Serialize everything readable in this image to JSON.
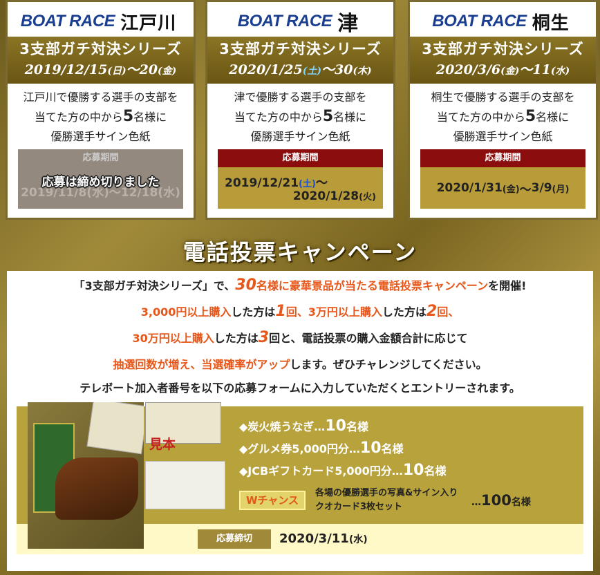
{
  "cards": [
    {
      "logo": "BOAT RACE",
      "venue": "江戸川",
      "series": "3支部ガチ対決シリーズ",
      "date_start": "2019/12/15",
      "dow_start": "(日)",
      "tilde": "～",
      "date_end": "20",
      "dow_end": "(金)",
      "desc1": "江戸川で優勝する選手の支部を",
      "desc2a": "当てた方の中から",
      "desc_num": "5",
      "desc2b": "名様に",
      "desc3": "優勝選手サイン色紙",
      "period_label": "応募期間",
      "period_old": "2019/11/8(水)～12/18(水)",
      "closed": "応募は締め切りました"
    },
    {
      "logo": "BOAT RACE",
      "venue": "津",
      "series": "3支部ガチ対決シリーズ",
      "date_start": "2020/1/25",
      "dow_start": "(土)",
      "tilde": "～",
      "date_end": "30",
      "dow_end": "(木)",
      "desc1": "津で優勝する選手の支部を",
      "desc2a": "当てた方の中から",
      "desc_num": "5",
      "desc2b": "名様に",
      "desc3": "優勝選手サイン色紙",
      "period_label": "応募期間",
      "p_line1": "2019/12/21",
      "p_dow1": "(土)",
      "p_tilde": "～",
      "p_line2": "2020/1/28",
      "p_dow2": "(火)"
    },
    {
      "logo": "BOAT RACE",
      "venue": "桐生",
      "series": "3支部ガチ対決シリーズ",
      "date_start": "2020/3/6",
      "dow_start": "(金)",
      "tilde": "～",
      "date_end": "11",
      "dow_end": "(水)",
      "desc1": "桐生で優勝する選手の支部を",
      "desc2a": "当てた方の中から",
      "desc_num": "5",
      "desc2b": "名様に",
      "desc3": "優勝選手サイン色紙",
      "period_label": "応募期間",
      "p_val": "2020/1/31",
      "p_dow1": "(金)",
      "p_tilde": "～",
      "p_val2": "3/9",
      "p_dow2": "(月)"
    }
  ],
  "campaign": {
    "title": "電話投票キャンペーン",
    "l1a": "「3支部ガチ対決シリーズ」で、",
    "l1num": "30",
    "l1b": "名様に豪華景品が当たる電話投票キャンペーン",
    "l1c": "を開催!",
    "l2a": "3,000円以上購入",
    "l2b": "した方は",
    "l2n1": "1",
    "l2c": "回、",
    "l2d": "3万円以上購入",
    "l2e": "した方は",
    "l2n2": "2",
    "l2f": "回、",
    "l3a": "30万円以上購入",
    "l3b": "した方は",
    "l3n": "3",
    "l3c": "回と、電話投票の購入金額合計に応じて",
    "l4a": "抽選回数が増え、当選確率がアップ",
    "l4b": "します。ぜひチャレンジしてください。",
    "l5": "テレボート加入者番号を以下の応募フォームに入力していただくとエントリーされます。",
    "prizes": [
      {
        "name": "◆炭火焼うなぎ…",
        "count": "10",
        "unit": "名様"
      },
      {
        "name": "◆グルメ券5,000円分…",
        "count": "10",
        "unit": "名様"
      },
      {
        "name": "◆JCBギフトカード5,000円分…",
        "count": "10",
        "unit": "名様"
      }
    ],
    "mihon": "見本",
    "wchance": "Wチャンス",
    "w_desc1": "各場の優勝選手の写真&サイン入り",
    "w_desc2": "クオカード3枚セット",
    "w_dots": "…",
    "w_count": "100",
    "w_unit": "名様",
    "deadline_label": "応募締切",
    "deadline_date": "2020/3/11",
    "deadline_dow": "(水)"
  }
}
